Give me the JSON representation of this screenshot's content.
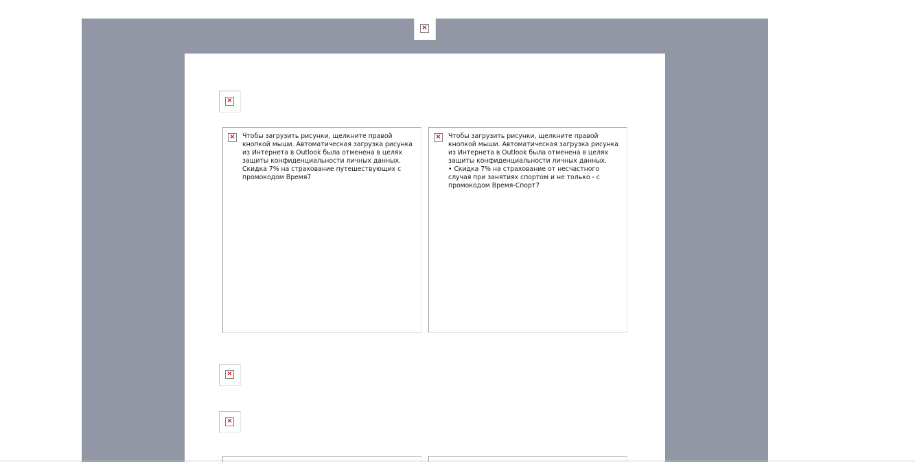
{
  "broken_image_glyph": "×",
  "colors": {
    "band_background": "#9197a5",
    "sheet_background": "#ffffff",
    "broken_icon_x": "#d40000"
  },
  "blocked_notice": "Чтобы загрузить рисунки, щелкните правой кнопкой мыши. Автоматическая загрузка рисунка из Интернета в Outlook была отменена в целях защиты конфиденциальности личных данных.",
  "promos": [
    {
      "alt": "Скидка 7% на страхование путешествующих с промокодом Время7"
    },
    {
      "alt": "•  Скидка 7% на страхование от несчастного случая при занятиях спортом и не только - с промокодом Время-Спорт7"
    }
  ]
}
